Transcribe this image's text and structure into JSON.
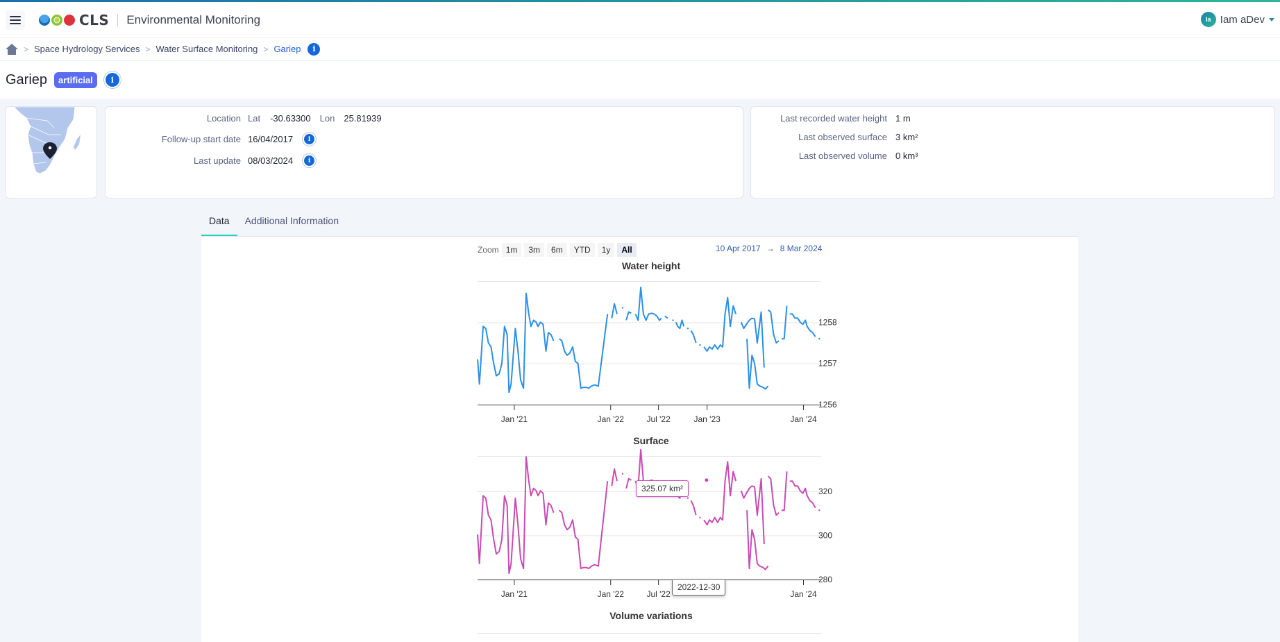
{
  "app": {
    "title": "Environmental Monitoring",
    "logo_text": "CLS",
    "user": {
      "initials": "Ia",
      "name": "Iam aDev"
    }
  },
  "breadcrumb": {
    "items": [
      "Space Hydrology Services",
      "Water Surface Monitoring"
    ],
    "current": "Gariep"
  },
  "page": {
    "title": "Gariep",
    "badge": "artificial"
  },
  "info": {
    "location_label": "Location",
    "lat_label": "Lat",
    "lat": "-30.63300",
    "lon_label": "Lon",
    "lon": "25.81939",
    "start_label": "Follow-up start date",
    "start_date": "16/04/2017",
    "update_label": "Last update",
    "update_date": "08/03/2024"
  },
  "stats": {
    "height_label": "Last recorded water height",
    "height_value": "1 m",
    "surface_label": "Last observed surface",
    "surface_value": "3 km²",
    "volume_label": "Last observed volume",
    "volume_value": "0 km³"
  },
  "tabs": [
    {
      "label": "Data",
      "active": true
    },
    {
      "label": "Additional Information",
      "active": false
    }
  ],
  "zoom": {
    "label": "Zoom",
    "buttons": [
      "1m",
      "3m",
      "6m",
      "YTD",
      "1y",
      "All"
    ],
    "selected": "All",
    "range_from": "10 Apr 2017",
    "range_arrow": "→",
    "range_to": "8 Mar 2024"
  },
  "tooltip": {
    "value": "325.07 km²",
    "date": "2022-12-30"
  },
  "chart_data": [
    {
      "type": "line",
      "title": "Water height",
      "color": "#2b8fe8",
      "x_range": [
        "2020-08-15",
        "2024-03-08"
      ],
      "ylim": [
        1256,
        1259
      ],
      "yticks": [
        1256,
        1257,
        1258
      ],
      "xticks": [
        {
          "date": "2021-01-01",
          "label": "Jan '21"
        },
        {
          "date": "2022-01-01",
          "label": "Jan '22"
        },
        {
          "date": "2022-07-01",
          "label": "Jul '22"
        },
        {
          "date": "2023-01-01",
          "label": "Jan '23"
        },
        {
          "date": "2024-01-01",
          "label": "Jan '24"
        }
      ],
      "points": [
        [
          "2020-08-15",
          1257.1
        ],
        [
          "2020-08-22",
          1256.5
        ],
        [
          "2020-09-05",
          1257.9
        ],
        [
          "2020-09-15",
          1257.85
        ],
        [
          "2020-09-25",
          1257.5
        ],
        [
          "2020-10-05",
          1257.4
        ],
        [
          "2020-10-15",
          1257.0
        ],
        [
          "2020-10-25",
          1256.7
        ],
        [
          "2020-11-05",
          1256.75
        ],
        [
          "2020-11-15",
          1257.0
        ],
        [
          "2020-11-25",
          1257.9
        ],
        [
          "2020-12-05",
          1257.7
        ],
        [
          "2020-12-12",
          1256.3
        ],
        [
          "2020-12-20",
          1256.5
        ],
        [
          "2021-01-05",
          1257.85
        ],
        [
          "2021-01-15",
          1257.3
        ],
        [
          "2021-01-25",
          1256.6
        ],
        [
          "2021-02-05",
          1256.4
        ],
        [
          "2021-02-15",
          1258.7
        ],
        [
          "2021-02-25",
          1258.2
        ],
        [
          "2021-03-05",
          1257.9
        ],
        [
          "2021-03-15",
          1258.05
        ],
        [
          "2021-03-25",
          1258.0
        ],
        [
          "2021-04-01",
          1257.9
        ],
        [
          "2021-04-10",
          1258.0
        ],
        [
          "2021-04-20",
          1257.95
        ],
        [
          "2021-05-01",
          1257.3
        ],
        [
          "2021-05-10",
          1257.75
        ],
        [
          "2021-05-20",
          1257.7
        ],
        [
          "2021-05-30",
          1257.55
        ],
        null,
        [
          "2021-06-20",
          1257.6
        ],
        [
          "2021-06-30",
          1257.55
        ],
        [
          "2021-07-10",
          1257.3
        ],
        [
          "2021-07-20",
          1257.2
        ],
        [
          "2021-07-30",
          1257.25
        ],
        [
          "2021-08-10",
          1257.4
        ],
        [
          "2021-08-20",
          1257.05
        ],
        [
          "2021-08-30",
          1257.0
        ],
        [
          "2021-09-10",
          1256.4
        ],
        [
          "2021-09-20",
          1256.42
        ],
        [
          "2021-10-01",
          1256.42
        ],
        [
          "2021-10-10",
          1256.4
        ],
        [
          "2021-10-20",
          1256.45
        ],
        [
          "2021-11-01",
          1256.48
        ],
        [
          "2021-11-15",
          1256.45
        ],
        [
          "2021-12-20",
          1258.2
        ],
        null,
        [
          "2022-01-05",
          1258.1
        ],
        [
          "2022-01-15",
          1258.45
        ],
        [
          "2022-01-25",
          1258.2
        ],
        null,
        [
          "2022-02-15",
          1258.35
        ],
        null,
        [
          "2022-03-01",
          1258.05
        ],
        [
          "2022-03-10",
          1258.25
        ],
        [
          "2022-03-20",
          1258.22
        ],
        null,
        [
          "2022-04-05",
          1258.2
        ],
        [
          "2022-04-15",
          1258.05
        ],
        [
          "2022-04-25",
          1258.85
        ],
        [
          "2022-05-05",
          1258.2
        ],
        [
          "2022-05-15",
          1258.05
        ],
        [
          "2022-05-25",
          1258.2
        ],
        [
          "2022-06-05",
          1258.22
        ],
        [
          "2022-06-15",
          1258.2
        ],
        [
          "2022-06-25",
          1258.15
        ],
        [
          "2022-07-05",
          1258.05
        ],
        [
          "2022-07-12",
          1258.1
        ],
        null,
        [
          "2022-07-25",
          1258.15
        ],
        [
          "2022-08-05",
          1258.1
        ],
        null,
        [
          "2022-08-25",
          1258.05
        ],
        null,
        [
          "2022-09-05",
          1258.0
        ],
        [
          "2022-09-12",
          1257.9
        ],
        [
          "2022-09-20",
          1257.85
        ],
        [
          "2022-09-28",
          1258.05
        ],
        [
          "2022-10-05",
          1257.9
        ],
        null,
        [
          "2022-10-20",
          1257.85
        ],
        null,
        [
          "2022-11-01",
          1257.8
        ],
        [
          "2022-11-10",
          1257.7
        ],
        [
          "2022-11-20",
          1257.5
        ],
        null,
        [
          "2022-12-05",
          1257.45
        ],
        null,
        [
          "2022-12-20",
          1257.4
        ],
        [
          "2023-01-01",
          1257.3
        ],
        [
          "2023-01-10",
          1257.4
        ],
        [
          "2023-01-20",
          1257.35
        ],
        [
          "2023-01-30",
          1257.45
        ],
        [
          "2023-02-10",
          1257.35
        ],
        [
          "2023-02-20",
          1257.45
        ],
        [
          "2023-03-01",
          1257.4
        ],
        [
          "2023-03-10",
          1258.2
        ],
        [
          "2023-03-20",
          1258.6
        ],
        [
          "2023-03-30",
          1257.9
        ],
        [
          "2023-04-10",
          1258.4
        ],
        [
          "2023-04-20",
          1258.2
        ],
        null,
        [
          "2023-05-10",
          1258.0
        ],
        [
          "2023-05-20",
          1257.85
        ],
        [
          "2023-05-30",
          1257.95
        ],
        [
          "2023-06-10",
          1258.05
        ],
        [
          "2023-06-20",
          1258.1
        ],
        [
          "2023-06-30",
          1258.08
        ],
        [
          "2023-07-10",
          1257.5
        ],
        [
          "2023-07-25",
          1258.25
        ],
        [
          "2023-08-05",
          1256.9
        ],
        null,
        [
          "2023-08-20",
          1258.3
        ],
        [
          "2023-08-30",
          1258.25
        ],
        [
          "2023-09-10",
          1257.7
        ],
        [
          "2023-09-20",
          1257.5
        ],
        [
          "2023-09-30",
          1257.55
        ],
        null,
        [
          "2023-10-10",
          1257.6
        ],
        [
          "2023-10-20",
          1257.6
        ],
        [
          "2023-10-30",
          1258.4
        ],
        null,
        [
          "2023-11-10",
          1258.2
        ],
        [
          "2023-11-20",
          1258.2
        ],
        [
          "2023-11-30",
          1258.1
        ],
        [
          "2023-12-10",
          1258.1
        ],
        [
          "2023-12-20",
          1258.0
        ],
        [
          "2023-12-30",
          1257.95
        ],
        [
          "2024-01-08",
          1258.05
        ],
        [
          "2024-01-15",
          1257.9
        ],
        [
          "2024-01-25",
          1257.8
        ],
        [
          "2024-02-05",
          1257.75
        ],
        [
          "2024-02-15",
          1257.65
        ],
        null,
        [
          "2024-03-01",
          1257.6
        ],
        null
      ],
      "tail_points": [
        [
          "2023-06-01",
          1257.6
        ],
        [
          "2023-06-10",
          1256.4
        ],
        [
          "2023-06-20",
          1257.2
        ],
        [
          "2023-06-30",
          1257.0
        ],
        [
          "2023-07-10",
          1256.5
        ],
        [
          "2023-07-20",
          1256.45
        ],
        [
          "2023-08-01",
          1256.42
        ],
        [
          "2023-08-10",
          1256.38
        ],
        [
          "2023-08-20",
          1256.45
        ]
      ]
    },
    {
      "type": "line",
      "title": "Surface",
      "color": "#c94ab4",
      "x_range": [
        "2020-08-15",
        "2024-03-08"
      ],
      "ylim": [
        280,
        336
      ],
      "yticks": [
        280,
        300,
        320
      ],
      "xticks": [
        {
          "date": "2021-01-01",
          "label": "Jan '21"
        },
        {
          "date": "2022-01-01",
          "label": "Jan '22"
        },
        {
          "date": "2022-07-01",
          "label": "Jul '22"
        },
        {
          "date": "2024-01-01",
          "label": "Jan '24"
        }
      ],
      "hovered_point": {
        "date": "2022-12-30",
        "value": 325.07,
        "unit": "km²"
      }
    },
    {
      "type": "line",
      "title": "Volume variations"
    }
  ]
}
